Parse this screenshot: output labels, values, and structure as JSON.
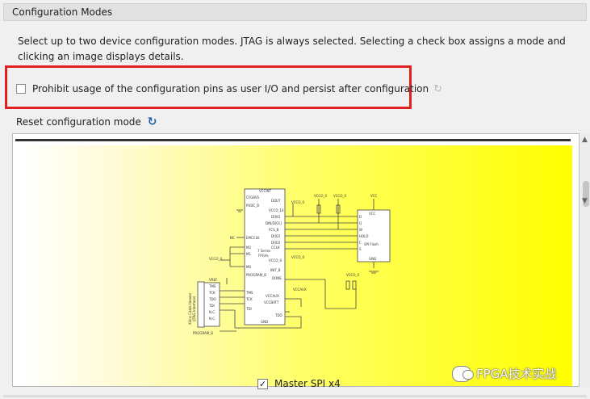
{
  "panel": {
    "title": "Configuration Modes",
    "description": "Select up to two device configuration modes. JTAG is always selected. Selecting a check box assigns a mode and clicking an image displays details."
  },
  "options": {
    "prohibit_label": "Prohibit usage of the configuration pins as user I/O and persist after configuration",
    "prohibit_checked": false,
    "reset_label": "Reset configuration mode"
  },
  "mode": {
    "label": "Master SPI x4",
    "checked": true,
    "check_glyph": "✓"
  },
  "schematic": {
    "fpga_title": "7 Series FPGAs",
    "flash_title": "SPI Flash",
    "fpga_pins_left": [
      "CFGBVS",
      "PUDC_B",
      "EMCCLK",
      "M2",
      "M1",
      "M0",
      "PROGRAM_B",
      "TMS",
      "TCK",
      "TDI"
    ],
    "fpga_pins_right": [
      "VCCINT",
      "DOUT",
      "VCCO_14",
      "D[00]",
      "DIN/D[01]",
      "FCS_B",
      "D[02]",
      "D[03]",
      "CCLK",
      "VCCO_0",
      "INIT_B",
      "DONE",
      "VCCAUX",
      "VCCBATT",
      "TDO",
      "GND"
    ],
    "flash_pins": [
      "VCC",
      "D",
      "Q",
      "W",
      "HOLD",
      "C",
      "S",
      "GND"
    ],
    "jtag_title": "Xilinx Cable Header (JTAG Interface)",
    "jtag_pins": [
      "VREF",
      "TMS",
      "TCK",
      "TDO",
      "TDI",
      "N.C.",
      "N.C."
    ],
    "labels": {
      "nc": "NC",
      "vcco0": "VCCO_0",
      "vcco14": "VCCO_14",
      "vcc": "VCC",
      "vccaux": "VCCAUX",
      "program_b": "PROGRAM_B"
    }
  },
  "watermark": "FPGA技术实战",
  "colors": {
    "highlight": "#e0201e",
    "accent": "#1e5fa8",
    "yellow": "#ffff00"
  },
  "icons": {
    "refresh": "refresh-icon",
    "check": "checkmark-icon"
  }
}
